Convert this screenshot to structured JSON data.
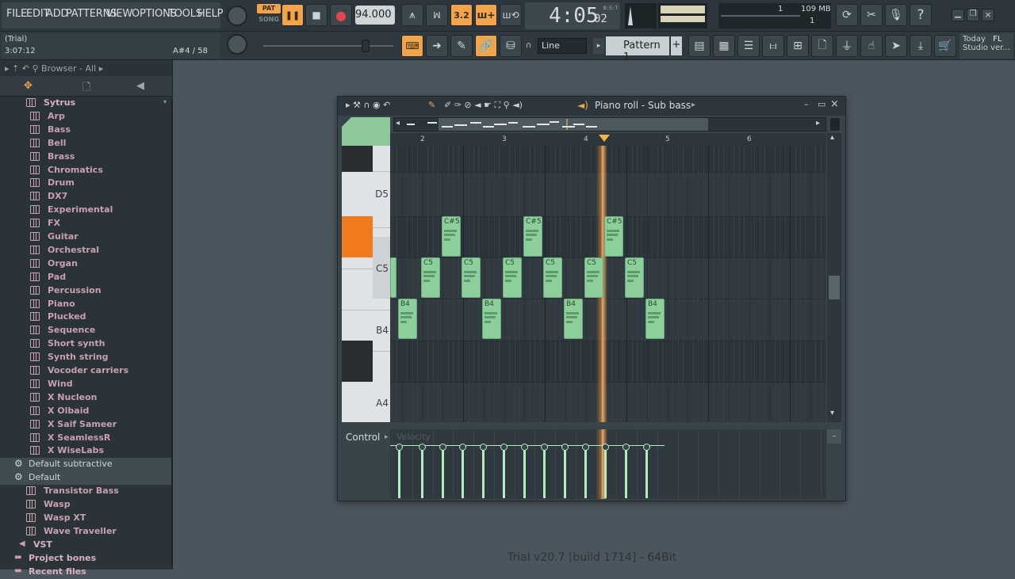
{
  "menu": [
    "FILE",
    "EDIT",
    "ADD",
    "PATTERNS",
    "VIEW",
    "OPTIONS",
    "TOOLS",
    "HELP"
  ],
  "transport": {
    "pat": "PAT",
    "song": "SONG",
    "tempo": "94.000",
    "time_main": "4:05",
    "time_sub": "02",
    "time_unit": "B:S:T"
  },
  "stats": {
    "cpu": "1",
    "memory": "109 MB",
    "voices": "1"
  },
  "hint": {
    "title": "(Trial)",
    "time": "3:07:12",
    "note": "A#4 / 58"
  },
  "toolbar": {
    "snap": "Line",
    "pattern": "Pattern 1",
    "plus": "+"
  },
  "news": {
    "line1": "Today",
    "tag": "FL",
    "line2": "Studio ver..."
  },
  "browser": {
    "title": "Browser - All",
    "items": [
      {
        "label": "Sytrus",
        "kind": "folder",
        "indent": 33
      },
      {
        "label": "Arp",
        "kind": "preset",
        "indent": 38
      },
      {
        "label": "Bass",
        "kind": "preset",
        "indent": 38
      },
      {
        "label": "Bell",
        "kind": "preset",
        "indent": 38
      },
      {
        "label": "Brass",
        "kind": "preset",
        "indent": 38
      },
      {
        "label": "Chromatics",
        "kind": "preset",
        "indent": 38
      },
      {
        "label": "Drum",
        "kind": "preset",
        "indent": 38
      },
      {
        "label": "DX7",
        "kind": "preset",
        "indent": 38
      },
      {
        "label": "Experimental",
        "kind": "preset",
        "indent": 38
      },
      {
        "label": "FX",
        "kind": "preset",
        "indent": 38
      },
      {
        "label": "Guitar",
        "kind": "preset",
        "indent": 38
      },
      {
        "label": "Orchestral",
        "kind": "preset",
        "indent": 38
      },
      {
        "label": "Organ",
        "kind": "preset",
        "indent": 38
      },
      {
        "label": "Pad",
        "kind": "preset",
        "indent": 38
      },
      {
        "label": "Percussion",
        "kind": "preset",
        "indent": 38
      },
      {
        "label": "Piano",
        "kind": "preset",
        "indent": 38
      },
      {
        "label": "Plucked",
        "kind": "preset",
        "indent": 38
      },
      {
        "label": "Sequence",
        "kind": "preset",
        "indent": 38
      },
      {
        "label": "Short synth",
        "kind": "preset",
        "indent": 38
      },
      {
        "label": "Synth string",
        "kind": "preset",
        "indent": 38
      },
      {
        "label": "Vocoder carriers",
        "kind": "preset",
        "indent": 38
      },
      {
        "label": "Wind",
        "kind": "preset",
        "indent": 38
      },
      {
        "label": "X Nucleon",
        "kind": "preset",
        "indent": 38
      },
      {
        "label": "X Olbaid",
        "kind": "preset",
        "indent": 38
      },
      {
        "label": "X Saif Sameer",
        "kind": "preset",
        "indent": 38
      },
      {
        "label": "X SeamlessR",
        "kind": "preset",
        "indent": 38
      },
      {
        "label": "X WiseLabs",
        "kind": "preset",
        "indent": 38
      },
      {
        "label": "Default subtractive",
        "kind": "gear",
        "indent": 18
      },
      {
        "label": "Default",
        "kind": "gear",
        "indent": 18
      },
      {
        "label": "Transistor Bass",
        "kind": "preset",
        "indent": 33
      },
      {
        "label": "Wasp",
        "kind": "preset",
        "indent": 33
      },
      {
        "label": "Wasp XT",
        "kind": "preset",
        "indent": 33
      },
      {
        "label": "Wave Traveller",
        "kind": "preset",
        "indent": 33
      },
      {
        "label": "VST",
        "kind": "vst",
        "indent": 24
      },
      {
        "label": "Project bones",
        "kind": "folder2",
        "indent": 18
      },
      {
        "label": "Recent files",
        "kind": "folder2",
        "indent": 18
      }
    ]
  },
  "pianoroll": {
    "title": "Piano roll - Sub bass",
    "bars": [
      "2",
      "3",
      "4",
      "5",
      "6"
    ],
    "keys": [
      "D5",
      "C5",
      "B4",
      "A4"
    ],
    "control_label": "Control",
    "control_param": "Velocity",
    "notes": [
      {
        "label": "",
        "start": 0.0,
        "pitch": "C5"
      },
      {
        "label": "B4",
        "start": 0.25,
        "pitch": "B4"
      },
      {
        "label": "C5",
        "start": 0.5,
        "pitch": "C5"
      },
      {
        "label": "C#5",
        "start": 0.75,
        "pitch": "C#5"
      },
      {
        "label": "C5",
        "start": 1.0,
        "pitch": "C5"
      },
      {
        "label": "B4",
        "start": 1.25,
        "pitch": "B4"
      },
      {
        "label": "C5",
        "start": 1.5,
        "pitch": "C5"
      },
      {
        "label": "C#5",
        "start": 1.75,
        "pitch": "C#5"
      },
      {
        "label": "C5",
        "start": 2.0,
        "pitch": "C5"
      },
      {
        "label": "B4",
        "start": 2.25,
        "pitch": "B4"
      },
      {
        "label": "C5",
        "start": 2.5,
        "pitch": "C5"
      },
      {
        "label": "C#5",
        "start": 2.75,
        "pitch": "C#5"
      },
      {
        "label": "C5",
        "start": 3.0,
        "pitch": "C5"
      },
      {
        "label": "B4",
        "start": 3.25,
        "pitch": "B4"
      }
    ]
  },
  "footer": "Trial v20.7 [build 1714] - 64Bit"
}
